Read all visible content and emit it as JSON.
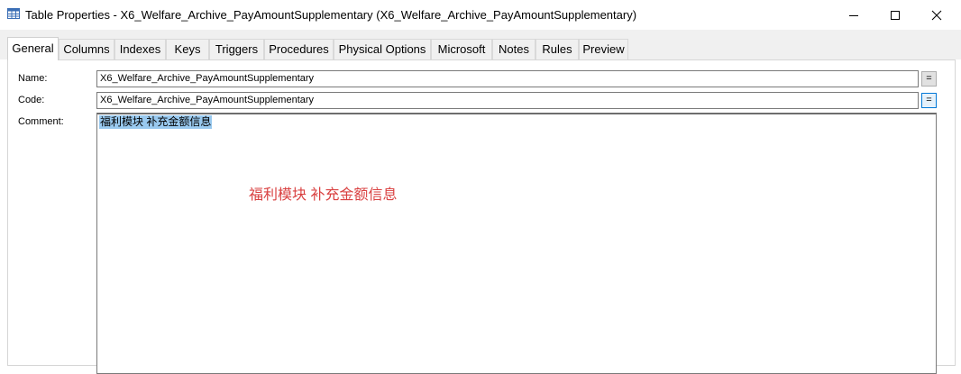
{
  "window": {
    "title": "Table Properties - X6_Welfare_Archive_PayAmountSupplementary (X6_Welfare_Archive_PayAmountSupplementary)",
    "icon": "table-icon",
    "controls": [
      "minimize-icon",
      "maximize-icon",
      "close-icon"
    ]
  },
  "tabs": [
    {
      "label": "General",
      "active": true
    },
    {
      "label": "Columns"
    },
    {
      "label": "Indexes"
    },
    {
      "label": "Keys"
    },
    {
      "label": "Triggers"
    },
    {
      "label": "Procedures"
    },
    {
      "label": "Physical Options"
    },
    {
      "label": "Microsoft"
    },
    {
      "label": "Notes"
    },
    {
      "label": "Rules"
    },
    {
      "label": "Preview"
    }
  ],
  "form": {
    "name_label": "Name:",
    "name_value": "X6_Welfare_Archive_PayAmountSupplementary",
    "code_label": "Code:",
    "code_value": "X6_Welfare_Archive_PayAmountSupplementary",
    "eq_label": "=",
    "comment_label": "Comment:",
    "comment_value": "福利模块 补充金额信息"
  },
  "annotation": {
    "text": "福利模块 补充金额信息",
    "color": "#d94040"
  },
  "colors": {
    "selection": "#99c9ef",
    "focus_border": "#0078d7"
  }
}
